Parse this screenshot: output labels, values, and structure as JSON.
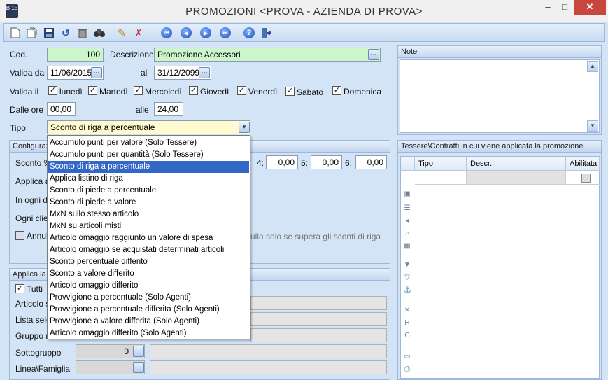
{
  "window": {
    "title": "PROMOZIONI <PROVA - AZIENDA DI PROVA>",
    "icon_text": "B 15",
    "minimize": "–",
    "maximize": "□",
    "close": "✕"
  },
  "form": {
    "cod_label": "Cod.",
    "cod_value": "100",
    "descrizione_label": "Descrizione",
    "descrizione_value": "Promozione Accessori",
    "valida_dal_label": "Valida dal",
    "valida_dal_value": "11/06/2015",
    "al_label": "al",
    "al_value": "31/12/2099",
    "valida_il_label": "Valida il",
    "days": [
      {
        "label": "lunedì",
        "checked": true
      },
      {
        "label": "Martedì",
        "checked": true
      },
      {
        "label": "Mercoledì",
        "checked": true
      },
      {
        "label": "Giovedì",
        "checked": true
      },
      {
        "label": "Venerdì",
        "checked": true
      },
      {
        "label": "Sabato",
        "checked": true
      },
      {
        "label": "Domenica",
        "checked": true
      }
    ],
    "dalle_ore_label": "Dalle ore",
    "dalle_ore_value": "00,00",
    "alle_label": "alle",
    "alle_value": "24,00",
    "tipo_label": "Tipo",
    "tipo_value": "Sconto di riga a percentuale"
  },
  "note_panel": {
    "title": "Note"
  },
  "config_panel": {
    "title": "Configuraz",
    "sconto_label": "Sconto %",
    "applica_label": "Applica al",
    "in_ogni_label": "In ogni do",
    "ogni_cliente_label": "Ogni clien",
    "annulla_label": "Annull",
    "annulla_hint": "ulla solo se supera gli sconti di riga",
    "sconti": [
      {
        "label": "4:",
        "value": "0,00"
      },
      {
        "label": "5:",
        "value": "0,00"
      },
      {
        "label": "6:",
        "value": "0,00"
      }
    ]
  },
  "applica_panel": {
    "title": "Applica la p",
    "tutti_label": "Tutti",
    "articolo_label": "Articolo s",
    "lista_label": "Lista sele",
    "gruppo_label": "Gruppo m",
    "sottogruppo_label": "Sottogruppo",
    "sottogruppo_value": "0",
    "linea_label": "Linea\\Famiglia"
  },
  "tessere_panel": {
    "title": "Tessere\\Contratti in cui viene applicata la promozione",
    "columns": [
      "Tipo",
      "Descr.",
      "Abilitata"
    ]
  },
  "dropdown": {
    "items": [
      "Accumulo punti per valore (Solo Tessere)",
      "Accumulo punti per quantità (Solo Tessere)",
      "Sconto di riga a percentuale",
      "Applica listino di riga",
      "Sconto di piede a percentuale",
      "Sconto di piede a valore",
      "MxN sullo stesso articolo",
      "MxN su articoli misti",
      "Articolo omaggio raggiunto un valore di spesa",
      "Articolo omaggio se acquistati determinati articoli",
      "Sconto percentuale differito",
      "Sconto a valore differito",
      "Articolo omaggio differito",
      "Provvigione a percentuale (Solo Agenti)",
      "Provvigione a percentuale differita (Solo Agenti)",
      "Provvigione a valore differita (Solo Agenti)",
      "Articolo omaggio differito (Solo Agenti)"
    ],
    "selected_index": 2
  }
}
